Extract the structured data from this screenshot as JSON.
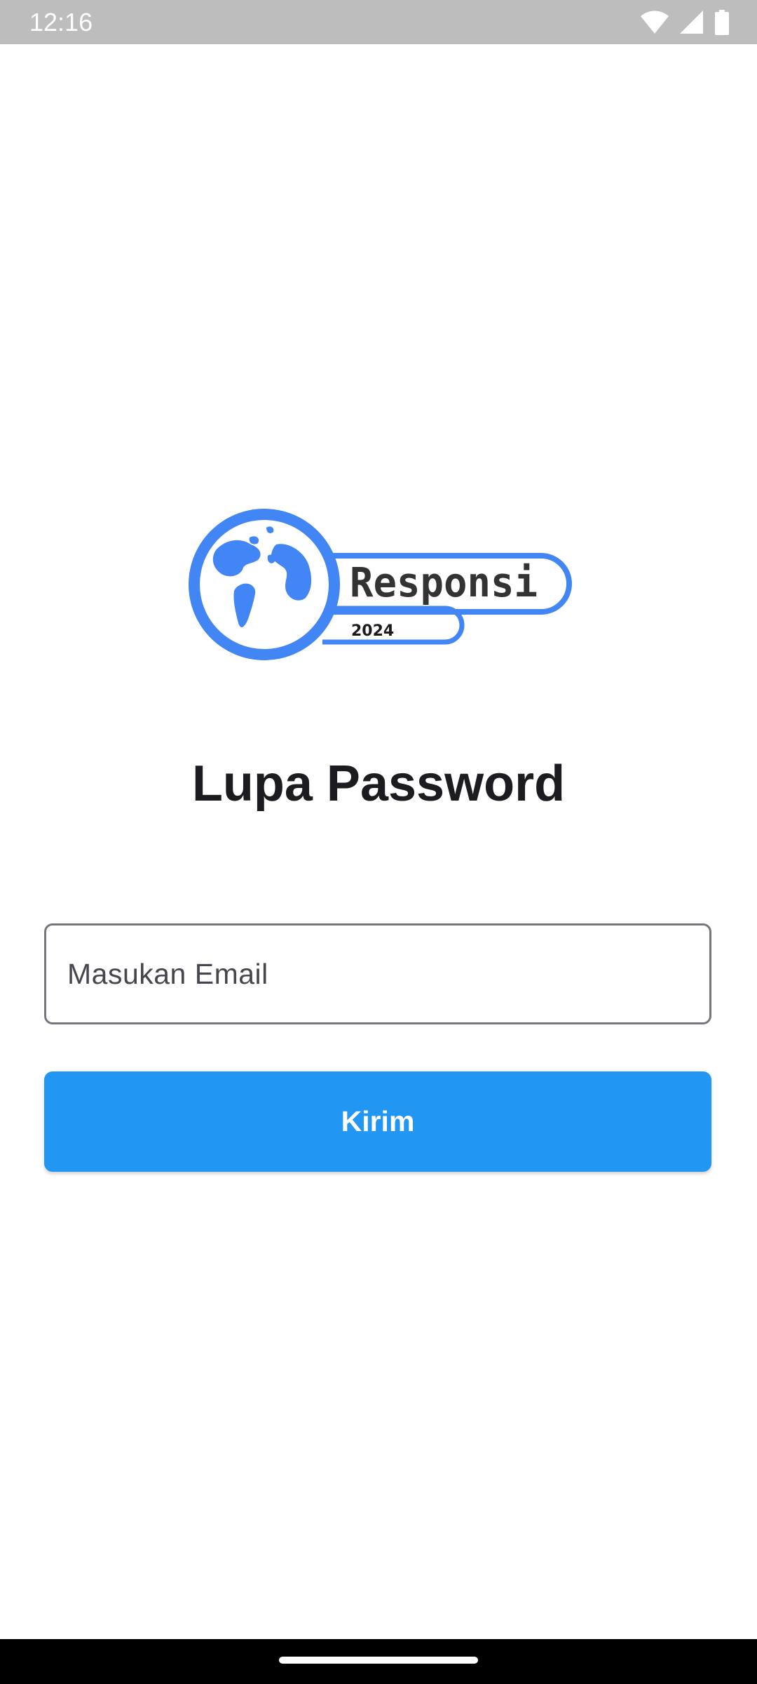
{
  "status_bar": {
    "time": "12:16",
    "icons": [
      "wifi-icon",
      "signal-icon",
      "battery-icon"
    ]
  },
  "logo": {
    "brand_text": "Responsi",
    "year_text": "2024",
    "icon": "globe-icon",
    "color": "#4285f4"
  },
  "page": {
    "title": "Lupa Password"
  },
  "form": {
    "email_placeholder": "Masukan Email",
    "email_value": "",
    "submit_label": "Kirim"
  },
  "colors": {
    "accent": "#2196f3",
    "logo_blue": "#4285f4",
    "status_bar": "#bdbdbd",
    "nav_bar": "#000000"
  }
}
